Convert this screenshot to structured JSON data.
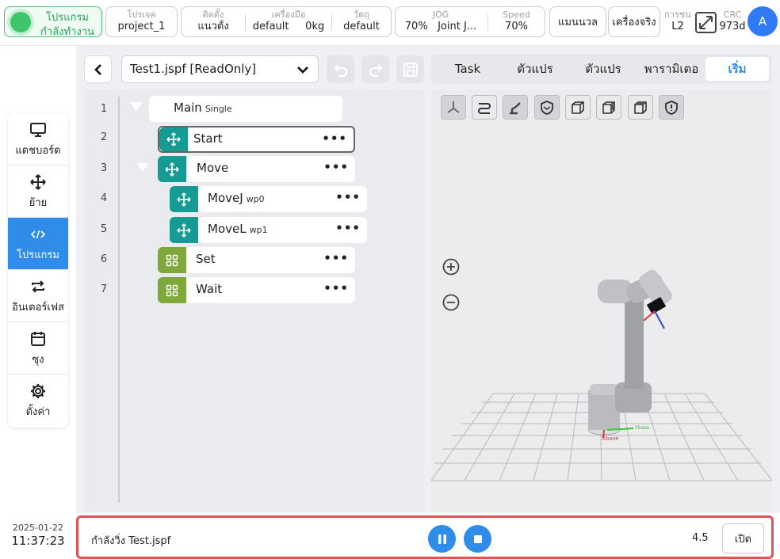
{
  "topbar": {
    "status": {
      "line1": "โปรแกรม",
      "line2": "กำลังทำงาน",
      "color": "#3dc66a"
    },
    "project": {
      "label": "โปรเจค",
      "value": "project_1"
    },
    "mount": {
      "label": "ติดตั้ง",
      "value": "แนวตั้ง"
    },
    "tool": {
      "label": "เครื่องมือ",
      "name": "default",
      "weight": "0kg"
    },
    "object": {
      "label": "วัตถุ",
      "value": "default"
    },
    "jog": {
      "label": "JOG",
      "percent": "70%",
      "mode": "Joint J..."
    },
    "speed": {
      "label": "Speed",
      "value": "70%"
    },
    "manual_label": "แมนนวล",
    "real_robot_label": "เครื่องจริง",
    "safety": {
      "label": "การชน",
      "value": "L2"
    },
    "crc": {
      "label": "CRC",
      "value": "973d"
    },
    "avatar_letter": "A",
    "accent": "#2f8ce8"
  },
  "sidebar": {
    "items": [
      {
        "label": "แดชบอร์ด",
        "icon": "monitor-icon"
      },
      {
        "label": "ย้าย",
        "icon": "move-arrows-icon"
      },
      {
        "label": "โปรแกรม",
        "icon": "code-icon",
        "active": true
      },
      {
        "label": "อินเตอร์เฟส",
        "icon": "swap-icon"
      },
      {
        "label": "ซุง",
        "icon": "calendar-icon"
      },
      {
        "label": "ตั้งค่า",
        "icon": "gear-icon"
      }
    ],
    "date": "2025-01-22",
    "time": "11:37:23"
  },
  "program": {
    "file": "Test1.jspf [ReadOnly]",
    "nodes": [
      {
        "line": "1",
        "name": "Main",
        "sub": "Single"
      },
      {
        "line": "2",
        "name": "Start",
        "sub": ""
      },
      {
        "line": "3",
        "name": "Move",
        "sub": ""
      },
      {
        "line": "4",
        "name": "MoveJ",
        "sub": "wp0"
      },
      {
        "line": "5",
        "name": "MoveL",
        "sub": "wp1"
      },
      {
        "line": "6",
        "name": "Set",
        "sub": ""
      },
      {
        "line": "7",
        "name": "Wait",
        "sub": ""
      }
    ],
    "more": "•••"
  },
  "tabs": [
    "Task",
    "ตัวแปร",
    "ตัวแปร",
    "พารามิเตอ",
    "เริ่ม"
  ],
  "view3d": {
    "view_buttons": [
      "axes-view-icon",
      "path-view-icon",
      "robot-view-icon",
      "shield-view-icon",
      "cube-front-icon",
      "cube-side-icon",
      "cube-top-icon",
      "safety-shield-icon"
    ],
    "axis_labels": {
      "x": "Xbase",
      "y": "Ybase"
    }
  },
  "statusbar": {
    "running_text": "กำลังวิ่ง Test.jspf",
    "speed": "4.5",
    "open_label": "เปิด"
  }
}
